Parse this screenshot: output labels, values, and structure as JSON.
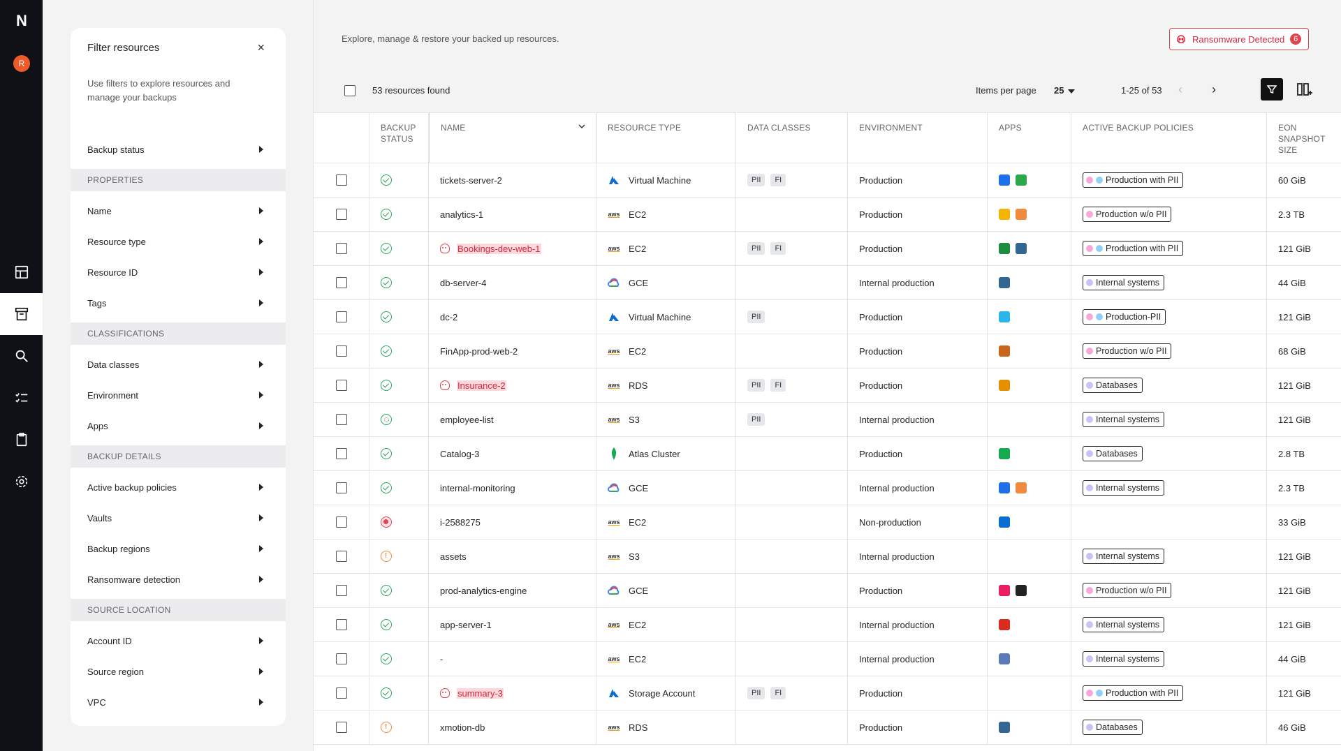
{
  "rail": {
    "logo": "N",
    "avatar": "R"
  },
  "filter": {
    "title": "Filter resources",
    "close": "×",
    "description": "Use filters to explore resources and manage your backups",
    "top_item": "Backup status",
    "sections": [
      {
        "name": "PROPERTIES",
        "items": [
          "Name",
          "Resource type",
          "Resource ID",
          "Tags"
        ]
      },
      {
        "name": "CLASSIFICATIONS",
        "items": [
          "Data classes",
          "Environment",
          "Apps"
        ]
      },
      {
        "name": "BACKUP DETAILS",
        "items": [
          "Active backup policies",
          "Vaults",
          "Backup regions",
          "Ransomware detection"
        ]
      },
      {
        "name": "SOURCE LOCATION",
        "items": [
          "Account ID",
          "Source region",
          "VPC"
        ]
      }
    ]
  },
  "header": {
    "subtitle": "Explore, manage & restore your backed up resources.",
    "ransomware_label": "Ransomware Detected",
    "ransomware_count": "6"
  },
  "toolbar": {
    "found": "53 resources found",
    "items_per_page_label": "Items per page",
    "items_per_page_value": "25",
    "range": "1-25 of 53",
    "prev": "‹",
    "next": "›"
  },
  "columns": [
    "BACKUP STATUS",
    "NAME",
    "RESOURCE TYPE",
    "DATA CLASSES",
    "ENVIRONMENT",
    "APPS",
    "ACTIVE BACKUP POLICIES",
    "EON SNAPSHOT SIZE"
  ],
  "colors": {
    "danger": "#e0454f",
    "ok": "#2aa55a",
    "warn": "#f08a3c",
    "pink_dot": "#f7a8d8",
    "blue_dot": "#8fd0f5",
    "purple_dot": "#c7c4f3"
  },
  "rows": [
    {
      "status": "ok",
      "name": "tickets-server-2",
      "danger": false,
      "rtype": "Virtual Machine",
      "ricon": "azure",
      "classes": [
        "PII",
        "FI"
      ],
      "env": "Production",
      "apps": [
        "#1f6feb",
        "#2ba84a"
      ],
      "policy": "Production with PII",
      "dots": [
        "pink",
        "blue"
      ],
      "size": "60 GiB"
    },
    {
      "status": "ok",
      "name": "analytics-1",
      "danger": false,
      "rtype": "EC2",
      "ricon": "aws",
      "classes": [],
      "env": "Production",
      "apps": [
        "#f4b400",
        "#f08a3c"
      ],
      "policy": "Production w/o PII",
      "dots": [
        "pink"
      ],
      "size": "2.3 TB"
    },
    {
      "status": "ok",
      "name": "Bookings-dev-web-1",
      "danger": true,
      "rtype": "EC2",
      "ricon": "aws",
      "classes": [
        "PII",
        "FI"
      ],
      "env": "Production",
      "apps": [
        "#1e8e3e",
        "#336791"
      ],
      "policy": "Production with PII",
      "dots": [
        "pink",
        "blue"
      ],
      "size": "121 GiB"
    },
    {
      "status": "ok",
      "name": "db-server-4",
      "danger": false,
      "rtype": "GCE",
      "ricon": "gcp",
      "classes": [],
      "env": "Internal production",
      "apps": [
        "#336791"
      ],
      "policy": "Internal systems",
      "dots": [
        "purple"
      ],
      "size": "44 GiB"
    },
    {
      "status": "ok",
      "name": "dc-2",
      "danger": false,
      "rtype": "Virtual Machine",
      "ricon": "azure",
      "classes": [
        "PII"
      ],
      "env": "Production",
      "apps": [
        "#2bb5e8"
      ],
      "policy": "Production-PII",
      "dots": [
        "pink",
        "blue"
      ],
      "size": "121 GiB"
    },
    {
      "status": "ok",
      "name": "FinApp-prod-web-2",
      "danger": false,
      "rtype": "EC2",
      "ricon": "aws",
      "classes": [],
      "env": "Production",
      "apps": [
        "#c8651b"
      ],
      "policy": "Production w/o PII",
      "dots": [
        "pink"
      ],
      "size": "68 GiB"
    },
    {
      "status": "ok",
      "name": "Insurance-2",
      "danger": true,
      "rtype": "RDS",
      "ricon": "aws",
      "classes": [
        "PII",
        "FI"
      ],
      "env": "Production",
      "apps": [
        "#e48e00"
      ],
      "policy": "Databases",
      "dots": [
        "purple"
      ],
      "size": "121 GiB"
    },
    {
      "status": "pend",
      "name": "employee-list",
      "danger": false,
      "rtype": "S3",
      "ricon": "aws",
      "classes": [
        "PII"
      ],
      "env": "Internal production",
      "apps": [],
      "policy": "Internal systems",
      "dots": [
        "purple"
      ],
      "size": "121 GiB"
    },
    {
      "status": "ok",
      "name": "Catalog-3",
      "danger": false,
      "rtype": "Atlas Cluster",
      "ricon": "mongo",
      "classes": [],
      "env": "Production",
      "apps": [
        "#13aa52"
      ],
      "policy": "Databases",
      "dots": [
        "purple"
      ],
      "size": "2.8 TB"
    },
    {
      "status": "ok",
      "name": "internal-monitoring",
      "danger": false,
      "rtype": "GCE",
      "ricon": "gcp",
      "classes": [],
      "env": "Internal production",
      "apps": [
        "#1f6feb",
        "#f08a3c"
      ],
      "policy": "Internal systems",
      "dots": [
        "purple"
      ],
      "size": "2.3 TB"
    },
    {
      "status": "err",
      "name": "i-2588275",
      "danger": false,
      "rtype": "EC2",
      "ricon": "aws",
      "classes": [],
      "env": "Non-production",
      "apps": [
        "#0a6ed1"
      ],
      "policy": "",
      "dots": [],
      "size": "33 GiB"
    },
    {
      "status": "warn",
      "name": "assets",
      "danger": false,
      "rtype": "S3",
      "ricon": "aws",
      "classes": [],
      "env": "Internal production",
      "apps": [],
      "policy": "Internal systems",
      "dots": [
        "purple"
      ],
      "size": "121 GiB"
    },
    {
      "status": "ok",
      "name": "prod-analytics-engine",
      "danger": false,
      "rtype": "GCE",
      "ricon": "gcp",
      "classes": [],
      "env": "Production",
      "apps": [
        "#e91e63",
        "#222222"
      ],
      "policy": "Production w/o PII",
      "dots": [
        "pink"
      ],
      "size": "121 GiB"
    },
    {
      "status": "ok",
      "name": "app-server-1",
      "danger": false,
      "rtype": "EC2",
      "ricon": "aws",
      "classes": [],
      "env": "Internal production",
      "apps": [
        "#d82c20"
      ],
      "policy": "Internal systems",
      "dots": [
        "purple"
      ],
      "size": "121 GiB"
    },
    {
      "status": "ok",
      "name": "-",
      "danger": false,
      "rtype": "EC2",
      "ricon": "aws",
      "classes": [],
      "env": "Internal production",
      "apps": [
        "#5a7bb5"
      ],
      "policy": "Internal systems",
      "dots": [
        "purple"
      ],
      "size": "44 GiB"
    },
    {
      "status": "ok",
      "name": "summary-3",
      "danger": true,
      "rtype": "Storage Account",
      "ricon": "azure",
      "classes": [
        "PII",
        "FI"
      ],
      "env": "Production",
      "apps": [],
      "policy": "Production with PII",
      "dots": [
        "pink",
        "blue"
      ],
      "size": "121 GiB"
    },
    {
      "status": "warn",
      "name": "xmotion-db",
      "danger": false,
      "rtype": "RDS",
      "ricon": "aws",
      "classes": [],
      "env": "Production",
      "apps": [
        "#336791"
      ],
      "policy": "Databases",
      "dots": [
        "purple"
      ],
      "size": "46 GiB"
    }
  ]
}
